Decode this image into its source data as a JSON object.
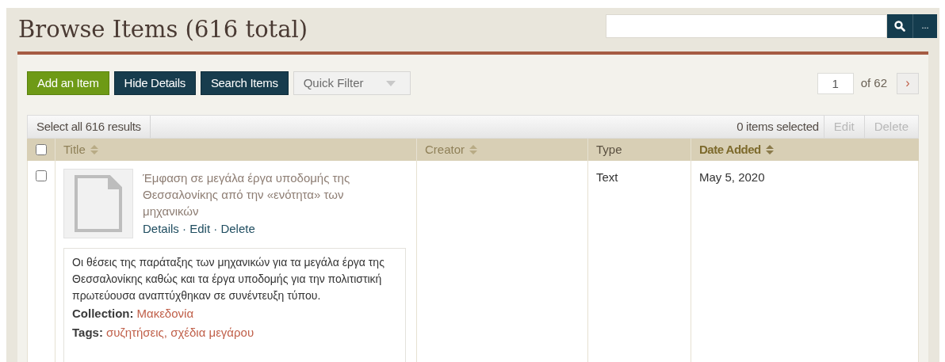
{
  "page_title": "Browse Items (616 total)",
  "search": {
    "more_button": "..."
  },
  "actions": [
    {
      "label": "Add an Item",
      "kind": "primary"
    },
    {
      "label": "Hide Details",
      "kind": "dark"
    },
    {
      "label": "Search Items",
      "kind": "dark"
    }
  ],
  "quick_filter": {
    "label": "Quick Filter"
  },
  "pagination": {
    "page": "1",
    "of": "of 62",
    "next": "›"
  },
  "bulk": {
    "select_all": "Select all 616 results",
    "selected_count": "0 items selected",
    "buttons": [
      {
        "label": "Edit",
        "disabled": true
      },
      {
        "label": "Delete",
        "disabled": true
      }
    ]
  },
  "table": {
    "select_all_checked": false,
    "columns": [
      {
        "label": "Title",
        "sortable": true,
        "sorted": false
      },
      {
        "label": "Creator",
        "sortable": true,
        "sorted": false
      },
      {
        "label": "Type",
        "sortable": false,
        "sorted": false
      },
      {
        "label": "Date Added",
        "sortable": true,
        "sorted": true
      }
    ],
    "rows": [
      {
        "checked": false,
        "title": "Έμφαση σε μεγάλα έργα υποδομής της Θεσσαλονίκης από την «ενότητα» των μηχανικών",
        "item_actions": [
          "Details",
          "Edit",
          "Delete"
        ],
        "action_separator": " · ",
        "description": "Οι θέσεις της παράταξης των μηχανικών για τα μεγάλα έργα της Θεσσαλονίκης καθώς και τα έργα υποδομής για την πολιτιστική πρωτεύουσα αναπτύχθηκαν σε συνέντευξη τύπου.",
        "collection_label": "Collection:",
        "collection": "Μακεδονία",
        "tags_label": "Tags:",
        "tags": [
          "συζητήσεις",
          "σχέδια μεγάρου"
        ],
        "tag_separator": ", ",
        "type": "Text",
        "date_added": "May 5, 2020"
      }
    ]
  }
}
